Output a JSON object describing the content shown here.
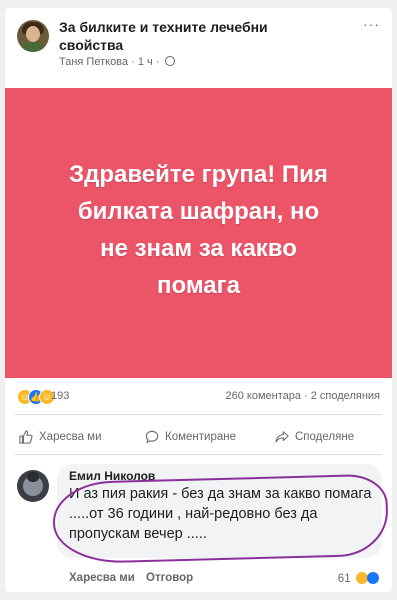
{
  "post": {
    "group_title": "За билките и техните лечебни свойства",
    "author": "Таня Петкова",
    "time": "1 ч",
    "meta_separator": "·",
    "more": "···",
    "text_lines": [
      "Здравейте група! Пия",
      "билката шафран, но",
      "не знам за какво",
      "помага"
    ],
    "background_color": "#ec5468"
  },
  "reactions": {
    "count": "193",
    "comments_shares": "260 коментара · 2 споделяния"
  },
  "actions": {
    "like": "Харесва ми",
    "comment": "Коментиране",
    "share": "Споделяне"
  },
  "comment": {
    "author": "Емил Николов",
    "text": "И аз пия ракия - без да знам за какво помага .....от 36 години , най-редовно без да пропускам вечер .....",
    "like": "Харесва ми",
    "reply": "Отговор",
    "reaction_count": "61"
  },
  "icons": {
    "reactions": [
      "haha-icon",
      "like-icon",
      "wow-icon"
    ],
    "actions": [
      "thumbs-up-icon",
      "comment-icon",
      "share-icon"
    ]
  }
}
